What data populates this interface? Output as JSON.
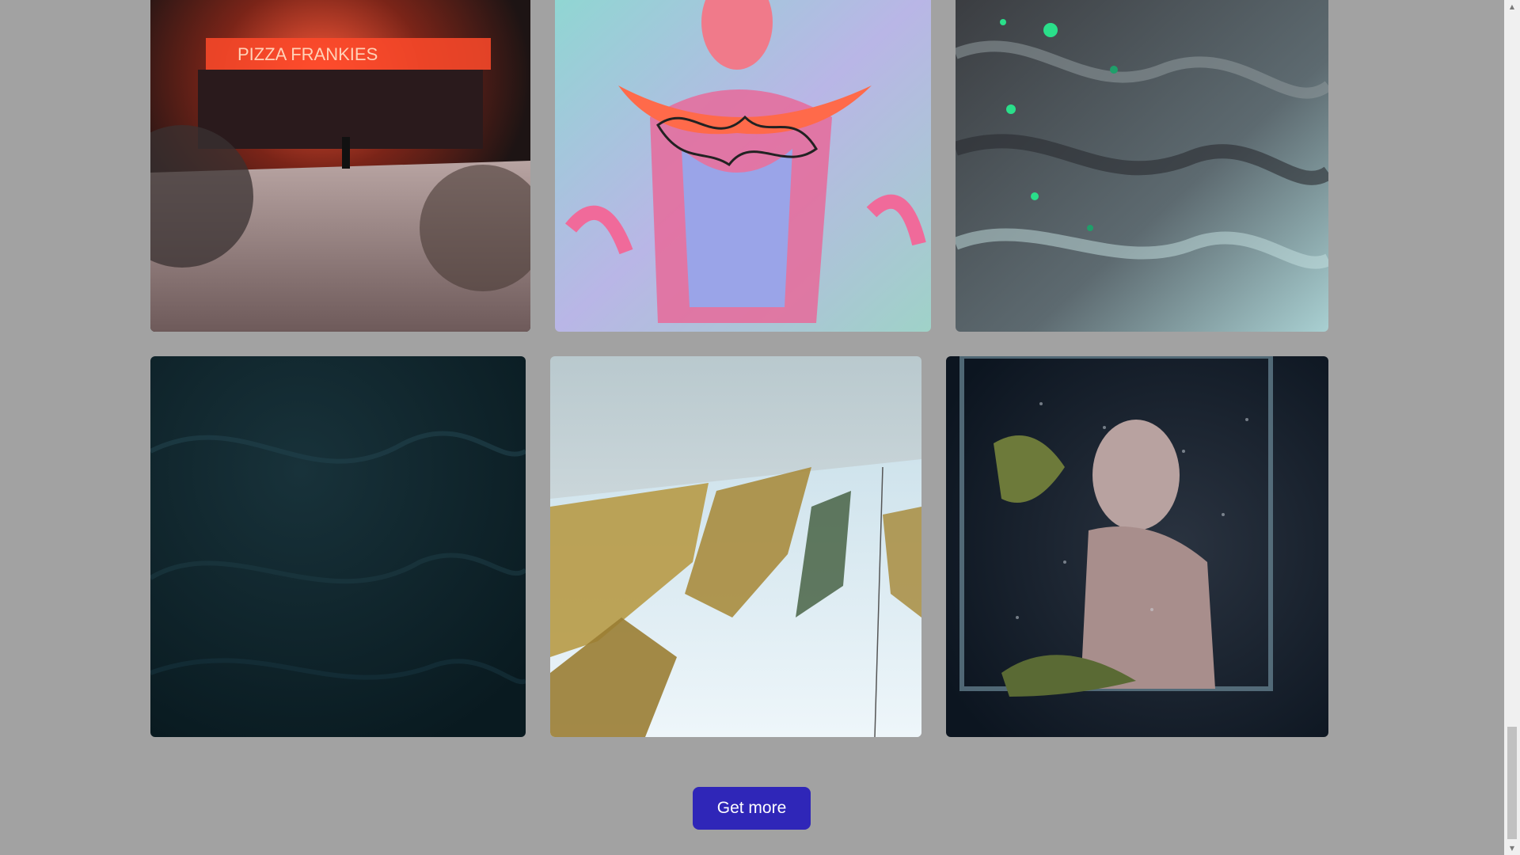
{
  "gallery": {
    "photos": [
      {
        "alt": "Neon-lit pizza storefront on a snowy street at night",
        "sign_text": "PIZZA FRANKIES"
      },
      {
        "alt": "Colorful psychedelic portrait artwork with graffiti tag"
      },
      {
        "alt": "Abstract dark marbled texture with green speckles"
      },
      {
        "alt": "Dark teal sand dunes texture"
      },
      {
        "alt": "Aerial view of snowy ski slopes and forest"
      },
      {
        "alt": "Woman behind a wet glass pane with pine branches"
      }
    ]
  },
  "actions": {
    "get_more_label": "Get more"
  },
  "scrollbar": {
    "up_icon": "▲",
    "down_icon": "▼"
  },
  "colors": {
    "background": "#a2a2a2",
    "button": "#2f26b8",
    "button_text": "#ffffff"
  }
}
